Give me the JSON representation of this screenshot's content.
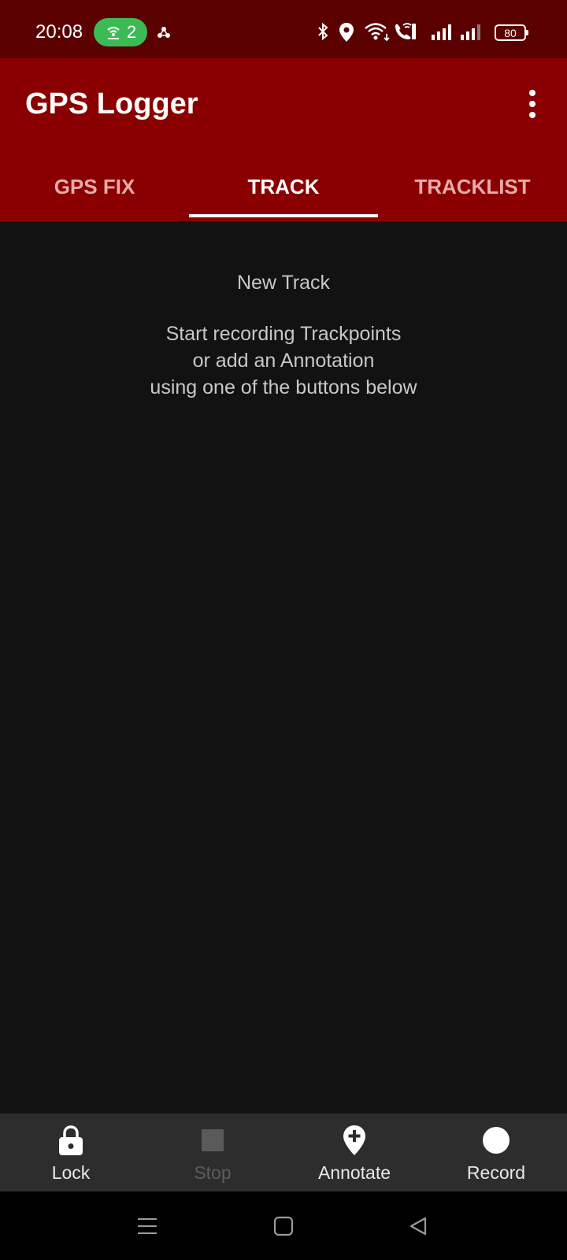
{
  "status_bar": {
    "time": "20:08",
    "hotspot_count": "2",
    "battery": "80",
    "icons": [
      "hotspot-icon",
      "app-notification-icon",
      "bluetooth-icon",
      "location-icon",
      "wifi-icon",
      "wifi-calling-icon",
      "signal-icon",
      "signal-icon",
      "battery-icon"
    ]
  },
  "app_bar": {
    "title": "GPS Logger",
    "menu_icon": "more-vert-icon"
  },
  "tabs": [
    {
      "label": "GPS FIX",
      "active": false
    },
    {
      "label": "TRACK",
      "active": true
    },
    {
      "label": "TRACKLIST",
      "active": false
    }
  ],
  "content": {
    "title": "New Track",
    "lines": [
      "Start recording Trackpoints",
      "or add an Annotation",
      "using one of the buttons below"
    ]
  },
  "toolbar": {
    "lock_label": "Lock",
    "stop_label": "Stop",
    "annotate_label": "Annotate",
    "record_label": "Record",
    "stop_enabled": false
  },
  "nav_bar": {
    "buttons": [
      "recents-icon",
      "home-icon",
      "back-icon"
    ]
  },
  "colors": {
    "status_bar": "#5a0000",
    "app_bar": "#8a0000",
    "background": "#121212",
    "toolbar": "#2d2d2d",
    "hotspot_pill": "#3cba54"
  }
}
